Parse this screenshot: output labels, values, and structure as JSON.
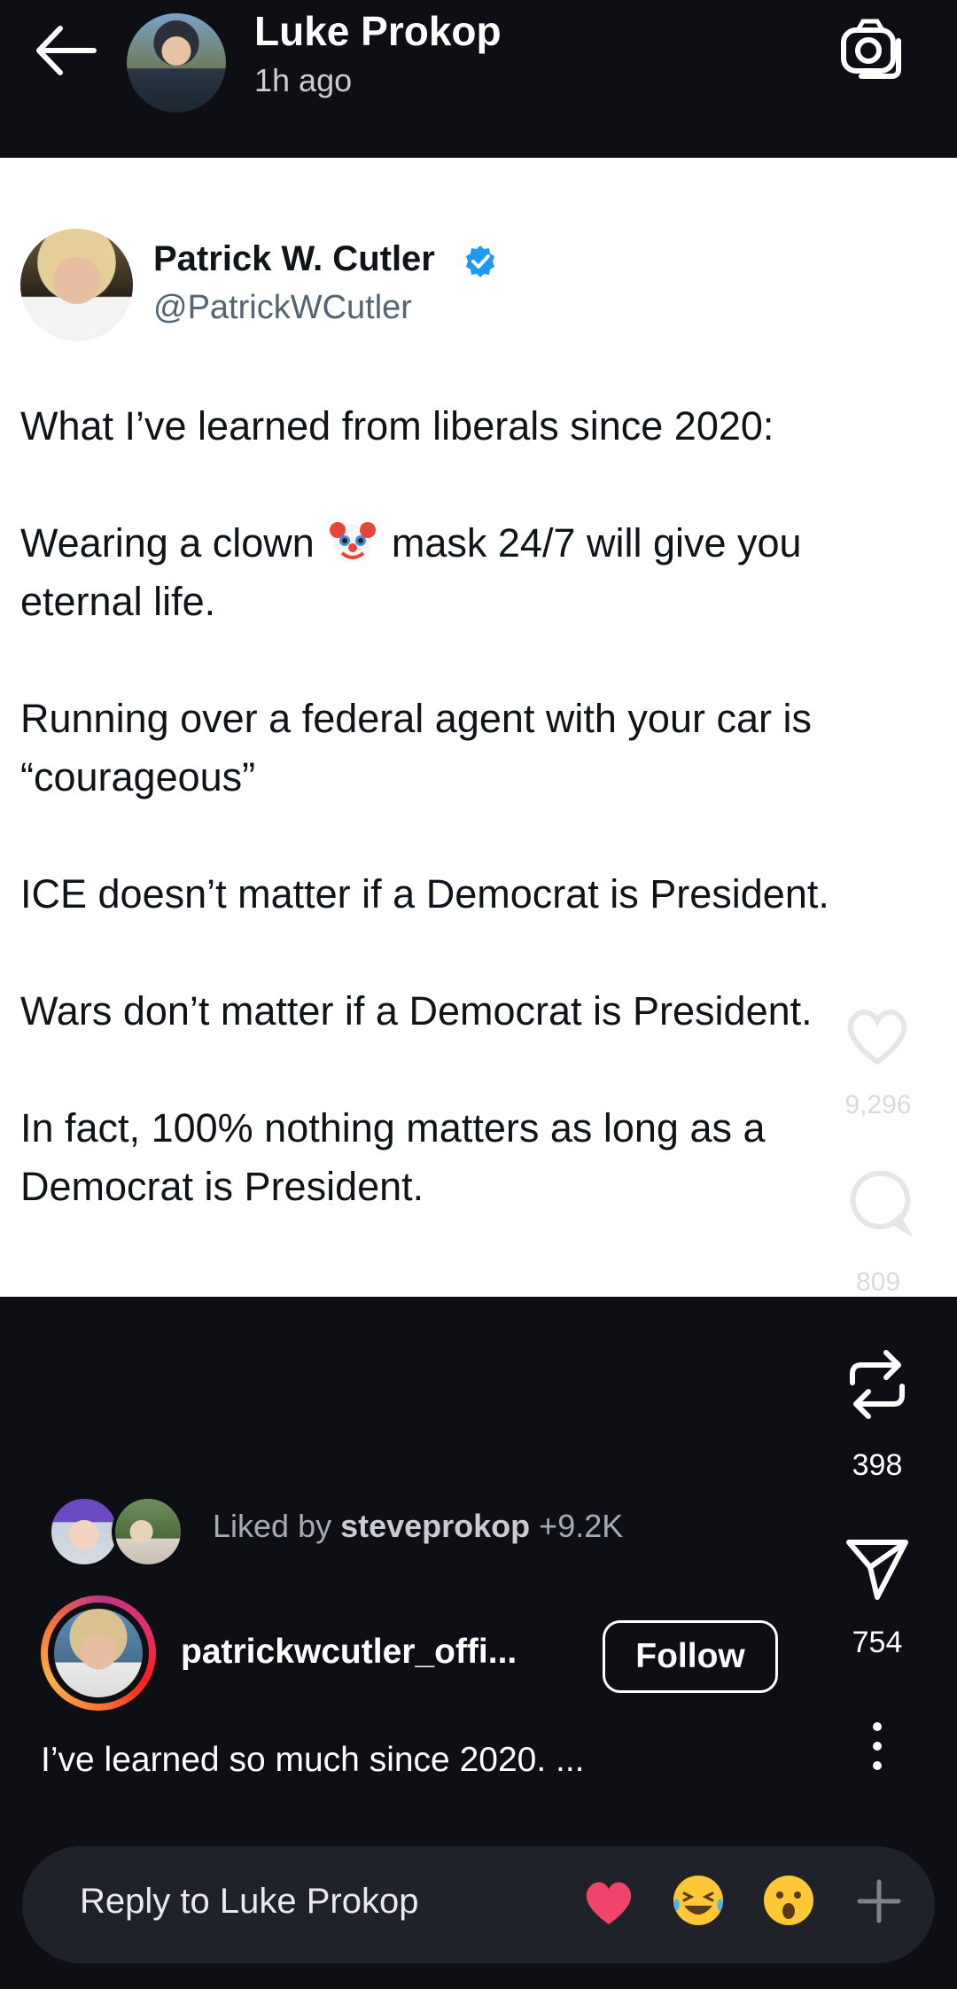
{
  "header": {
    "user_name": "Luke Prokop",
    "time_ago": "1h ago"
  },
  "tweet": {
    "author_name": "Patrick W. Cutler",
    "author_handle": "@PatrickWCutler",
    "paragraphs": [
      "What I’ve learned from liberals since 2020:",
      "Wearing a clown",
      "mask 24/7 will give you eternal life.",
      "Running over a federal agent with your car is “courageous”",
      "ICE doesn’t matter if a Democrat is President.",
      "Wars don’t matter if a Democrat is President.",
      "In fact, 100% nothing matters as long as a Democrat is President."
    ],
    "faded_like_count": "9,296",
    "faded_comment_count": "809"
  },
  "actions": {
    "repost_count": "398",
    "share_count": "754"
  },
  "liked_by": {
    "prefix": "Liked by ",
    "user": "steveprokop",
    "suffix": " +9.2K"
  },
  "post": {
    "author": "patrickwcutler_offi...",
    "follow_label": "Follow",
    "caption": "I’ve learned so much since 2020. ..."
  },
  "reply": {
    "placeholder": "Reply to Luke Prokop"
  },
  "icons": {
    "back": "back-arrow-icon",
    "camera": "camera-icon",
    "verified": "verified-badge-icon",
    "repost": "repost-icon",
    "send": "send-icon",
    "more": "more-vertical-icon",
    "add": "plus-icon"
  },
  "colors": {
    "background": "#0d0f14",
    "verified": "#1d9bf0",
    "reply_bar": "#1f2229"
  }
}
